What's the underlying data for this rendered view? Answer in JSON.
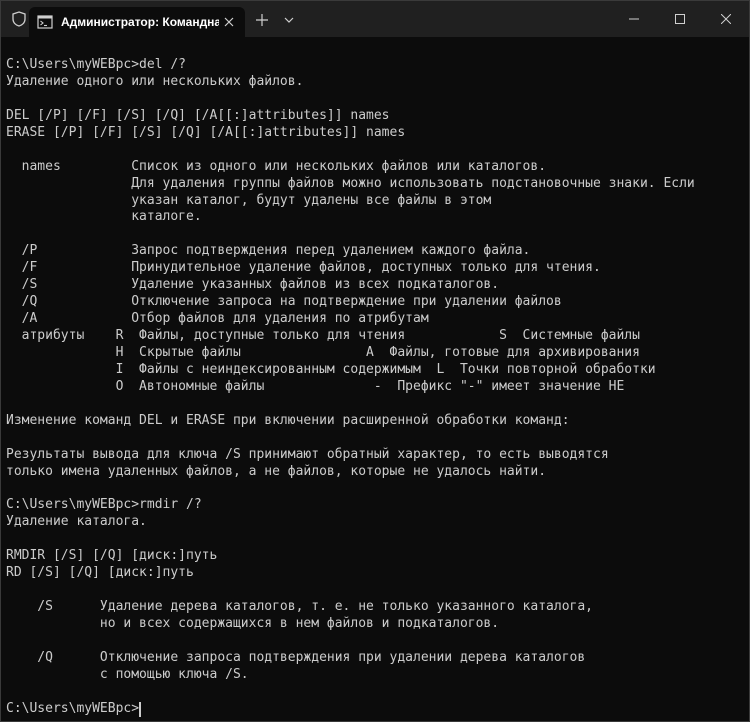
{
  "window": {
    "tab_title": "Администратор: Командная",
    "tab_icon": "terminal-icon",
    "controls": [
      "minimize-icon",
      "maximize-icon",
      "close-icon"
    ]
  },
  "console": {
    "lines": [
      "C:\\Users\\myWEBpc>del /?",
      "Удаление одного или нескольких файлов.",
      "",
      "DEL [/P] [/F] [/S] [/Q] [/A[[:]attributes]] names",
      "ERASE [/P] [/F] [/S] [/Q] [/A[[:]attributes]] names",
      "",
      "  names         Список из одного или нескольких файлов или каталогов.",
      "                Для удаления группы файлов можно использовать подстановочные знаки. Если",
      "                указан каталог, будут удалены все файлы в этом",
      "                каталоге.",
      "",
      "  /P            Запрос подтверждения перед удалением каждого файла.",
      "  /F            Принудительное удаление файлов, доступных только для чтения.",
      "  /S            Удаление указанных файлов из всех подкаталогов.",
      "  /Q            Отключение запроса на подтверждение при удалении файлов",
      "  /A            Отбор файлов для удаления по атрибутам",
      "  атрибуты    R  Файлы, доступные только для чтения            S  Системные файлы",
      "              H  Скрытые файлы                A  Файлы, готовые для архивирования",
      "              I  Файлы с неиндексированным содержимым  L  Точки повторной обработки",
      "              O  Автономные файлы              -  Префикс \"-\" имеет значение НЕ",
      "",
      "Изменение команд DEL и ERASE при включении расширенной обработки команд:",
      "",
      "Результаты вывода для ключа /S принимают обратный характер, то есть выводятся",
      "только имена удаленных файлов, а не файлов, которые не удалось найти.",
      "",
      "C:\\Users\\myWEBpc>rmdir /?",
      "Удаление каталога.",
      "",
      "RMDIR [/S] [/Q] [диск:]путь",
      "RD [/S] [/Q] [диск:]путь",
      "",
      "    /S      Удаление дерева каталогов, т. е. не только указанного каталога,",
      "            но и всех содержащихся в нем файлов и подкаталогов.",
      "",
      "    /Q      Отключение запроса подтверждения при удалении дерева каталогов",
      "            с помощью ключа /S.",
      ""
    ],
    "prompt": "C:\\Users\\myWEBpc>"
  }
}
